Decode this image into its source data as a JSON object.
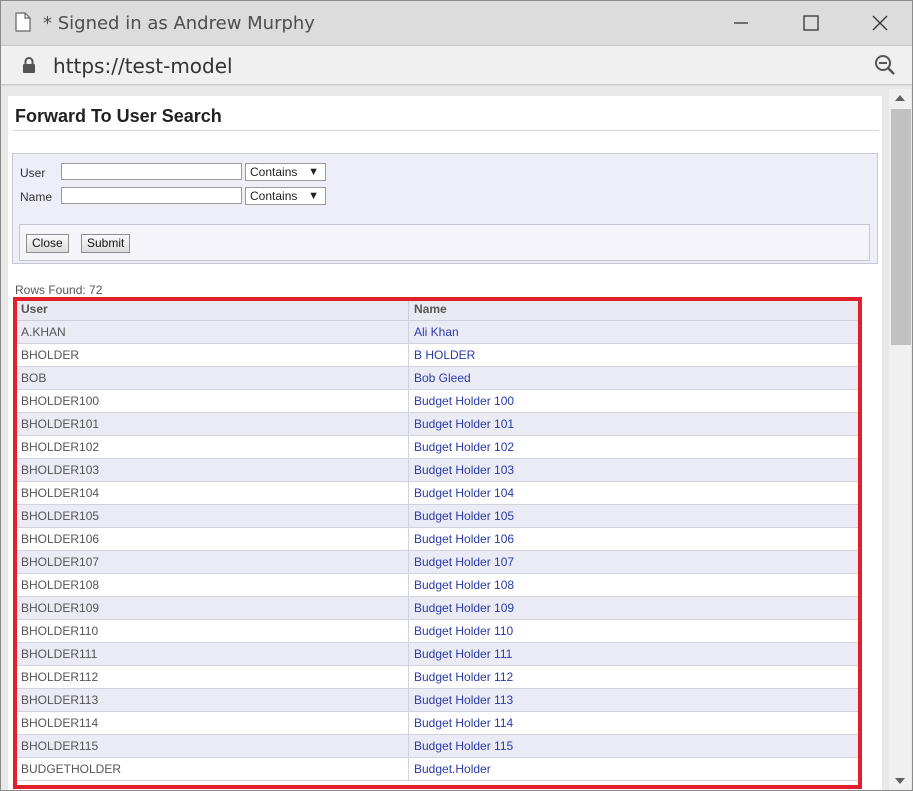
{
  "window": {
    "title": "* Signed in as Andrew Murphy",
    "url": "https://test-model",
    "icons": {
      "page": "document-icon",
      "minimize": "minimize-icon",
      "maximize": "maximize-icon",
      "close": "close-icon",
      "lock": "lock-icon",
      "zoom": "zoom-out-icon"
    }
  },
  "page": {
    "title": "Forward To User Search",
    "search": {
      "user_label": "User",
      "user_value": "",
      "user_operator": "Contains",
      "name_label": "Name",
      "name_value": "",
      "name_operator": "Contains",
      "close_label": "Close",
      "submit_label": "Submit"
    },
    "rows_found": "Rows Found: 72",
    "table": {
      "headers": {
        "user": "User",
        "name": "Name"
      },
      "rows": [
        {
          "user": "A.KHAN",
          "name": "Ali Khan"
        },
        {
          "user": "BHOLDER",
          "name": "B HOLDER"
        },
        {
          "user": "BOB",
          "name": "Bob Gleed"
        },
        {
          "user": "BHOLDER100",
          "name": "Budget Holder 100"
        },
        {
          "user": "BHOLDER101",
          "name": "Budget Holder 101"
        },
        {
          "user": "BHOLDER102",
          "name": "Budget Holder 102"
        },
        {
          "user": "BHOLDER103",
          "name": "Budget Holder 103"
        },
        {
          "user": "BHOLDER104",
          "name": "Budget Holder 104"
        },
        {
          "user": "BHOLDER105",
          "name": "Budget Holder 105"
        },
        {
          "user": "BHOLDER106",
          "name": "Budget Holder 106"
        },
        {
          "user": "BHOLDER107",
          "name": "Budget Holder 107"
        },
        {
          "user": "BHOLDER108",
          "name": "Budget Holder 108"
        },
        {
          "user": "BHOLDER109",
          "name": "Budget Holder 109"
        },
        {
          "user": "BHOLDER110",
          "name": "Budget Holder 110"
        },
        {
          "user": "BHOLDER111",
          "name": "Budget Holder 111"
        },
        {
          "user": "BHOLDER112",
          "name": "Budget Holder 112"
        },
        {
          "user": "BHOLDER113",
          "name": "Budget Holder 113"
        },
        {
          "user": "BHOLDER114",
          "name": "Budget Holder 114"
        },
        {
          "user": "BHOLDER115",
          "name": "Budget Holder 115"
        },
        {
          "user": "BUDGETHOLDER",
          "name": "Budget.Holder"
        }
      ]
    }
  },
  "colors": {
    "highlight": "#e0202b",
    "link": "#2a3aa8",
    "row_alt": "#ebebf5"
  }
}
